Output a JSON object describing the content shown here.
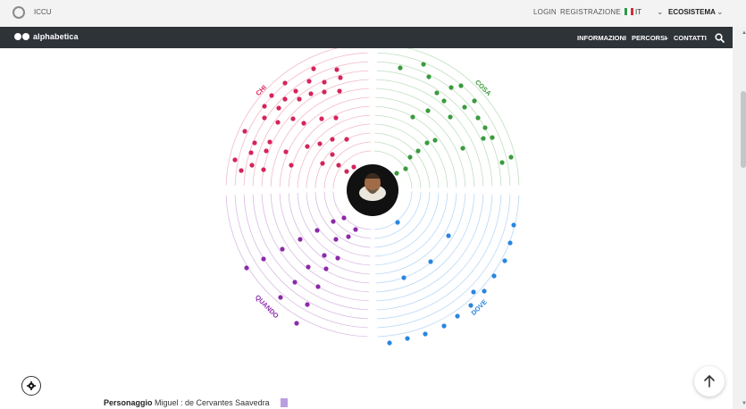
{
  "topbar": {
    "org": "ICCU",
    "login": "LOGIN",
    "register": "REGISTRAZIONE",
    "language": "IT",
    "ecosystem": "ECOSISTEMA"
  },
  "navbar": {
    "brand": "alphabetica",
    "items": [
      "INFORMAZIONI",
      "PERCORSI",
      "CONTATTI"
    ]
  },
  "viz": {
    "quadrants": [
      {
        "label": "CHI",
        "color": "#d6245a"
      },
      {
        "label": "COSA",
        "color": "#3a9b3e"
      },
      {
        "label": "DOVE",
        "color": "#2a86e0"
      },
      {
        "label": "QUANDO",
        "color": "#8c2aa8"
      }
    ]
  },
  "footer": {
    "label": "Personaggio",
    "value": "Miguel : de Cervantes Saavedra"
  },
  "icons": {
    "search": "search-icon",
    "settings": "gear-icon",
    "scroll_top": "arrow-up-icon",
    "bookmark": "bookmark-icon"
  }
}
